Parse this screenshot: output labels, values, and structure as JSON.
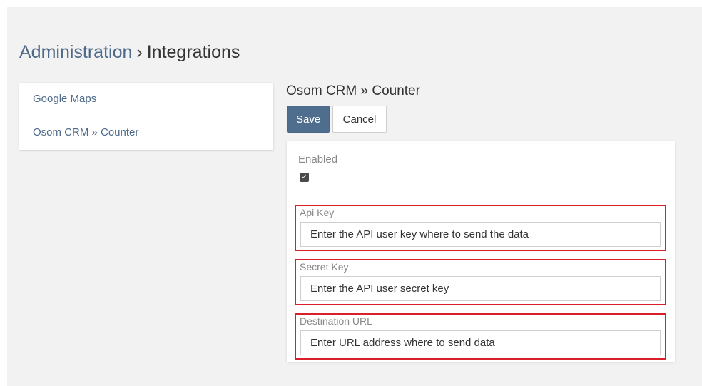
{
  "breadcrumb": {
    "parent": "Administration",
    "separator": "›",
    "current": "Integrations"
  },
  "sidebar": {
    "items": [
      {
        "label": "Google Maps"
      },
      {
        "label": "Osom CRM » Counter"
      }
    ]
  },
  "panel": {
    "title": "Osom CRM » Counter",
    "save_label": "Save",
    "cancel_label": "Cancel"
  },
  "form": {
    "enabled": {
      "label": "Enabled",
      "checked": true,
      "check_glyph": "✓"
    },
    "api_key": {
      "label": "Api Key",
      "value": "",
      "placeholder": "Enter the API user key where to send the data"
    },
    "secret_key": {
      "label": "Secret Key",
      "value": "",
      "placeholder": "Enter the API user secret key"
    },
    "destination_url": {
      "label": "Destination URL",
      "value": "",
      "placeholder": "Enter URL address where to send data"
    }
  },
  "colors": {
    "accent": "#4f6e8e",
    "link": "#4d6a8a",
    "highlight_border": "#d9202a",
    "background": "#f2f2f2"
  }
}
